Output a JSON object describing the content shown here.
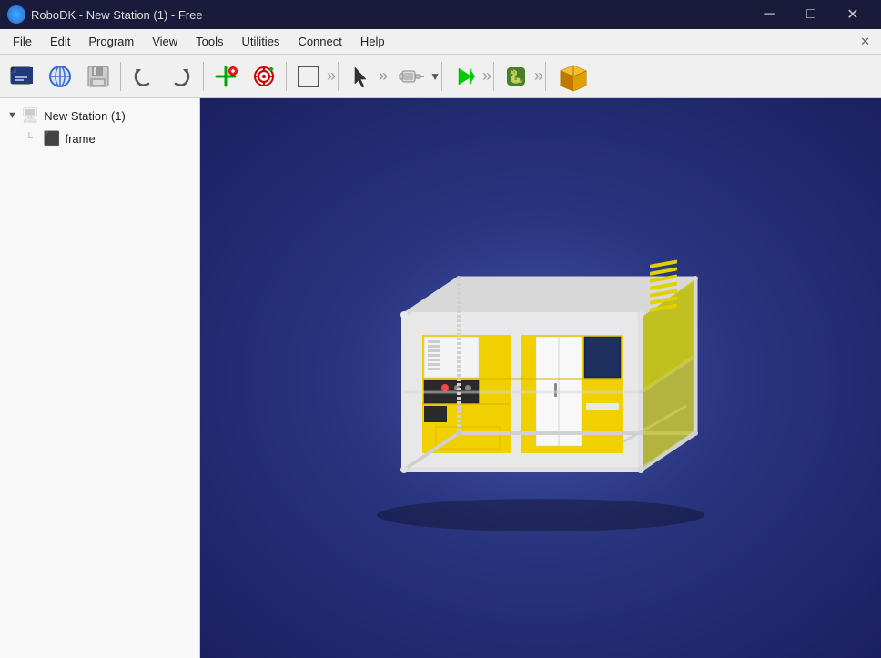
{
  "window": {
    "title": "RoboDK - New Station (1) - Free",
    "app_name": "RoboDK",
    "station_name": "New Station (1)",
    "edition": "Free"
  },
  "titlebar": {
    "minimize": "─",
    "maximize": "□",
    "close": "✕"
  },
  "menubar": {
    "items": [
      "File",
      "Edit",
      "Program",
      "View",
      "Tools",
      "Utilities",
      "Connect",
      "Help"
    ]
  },
  "toolbar": {
    "groups": [
      {
        "buttons": [
          "open-file",
          "open-web",
          "save"
        ]
      },
      {
        "buttons": [
          "undo",
          "redo"
        ]
      },
      {
        "buttons": [
          "add-item",
          "add-target"
        ]
      },
      {
        "buttons": [
          "fullscreen"
        ]
      },
      {
        "buttons": [
          "select-cursor"
        ]
      },
      {
        "buttons": [
          "robot-tool"
        ]
      },
      {
        "buttons": [
          "play",
          "step",
          "stop"
        ]
      },
      {
        "buttons": [
          "python"
        ]
      },
      {
        "buttons": [
          "package"
        ]
      }
    ]
  },
  "tree": {
    "station": "New Station (1)",
    "frame": "frame"
  },
  "colors": {
    "background_top": "#4455aa",
    "background_bottom": "#1a2060",
    "frame_color": "#e0e0e0",
    "panel_yellow": "#f0d000",
    "accent_blue": "#3366cc"
  }
}
